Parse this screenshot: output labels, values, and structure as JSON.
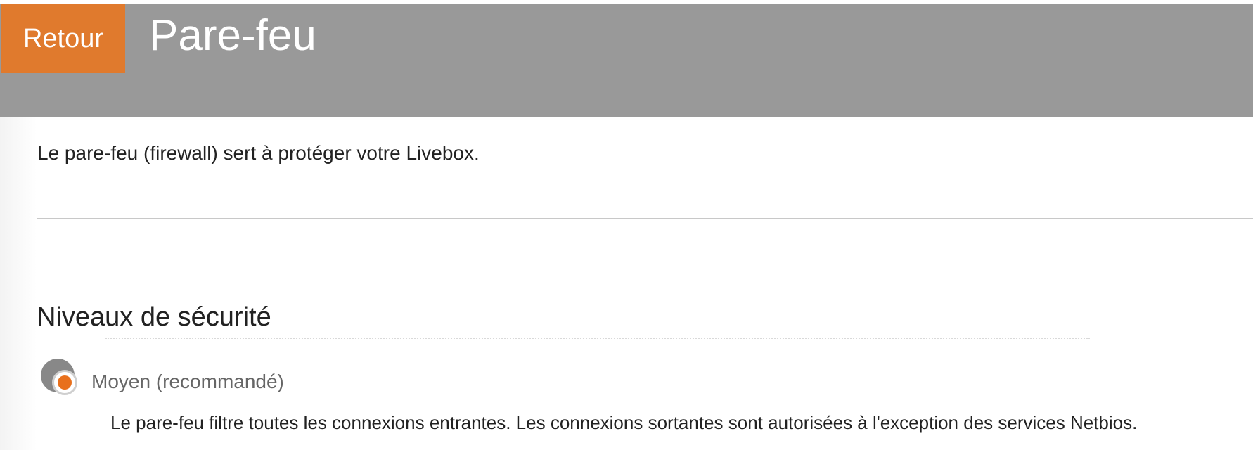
{
  "header": {
    "back_label": "Retour",
    "title": "Pare-feu",
    "background_color": "#999999",
    "back_button_color": "#e07a2d"
  },
  "intro": {
    "text": "Le pare-feu (firewall) sert à protéger votre Livebox."
  },
  "security_levels": {
    "title": "Niveaux de sécurité",
    "options": [
      {
        "label": "Moyen (recommandé)",
        "selected": true,
        "description": "Le pare-feu filtre toutes les connexions entrantes. Les connexions sortantes sont autorisées à l'exception des services Netbios.",
        "accent_color": "#e8701c"
      }
    ]
  }
}
